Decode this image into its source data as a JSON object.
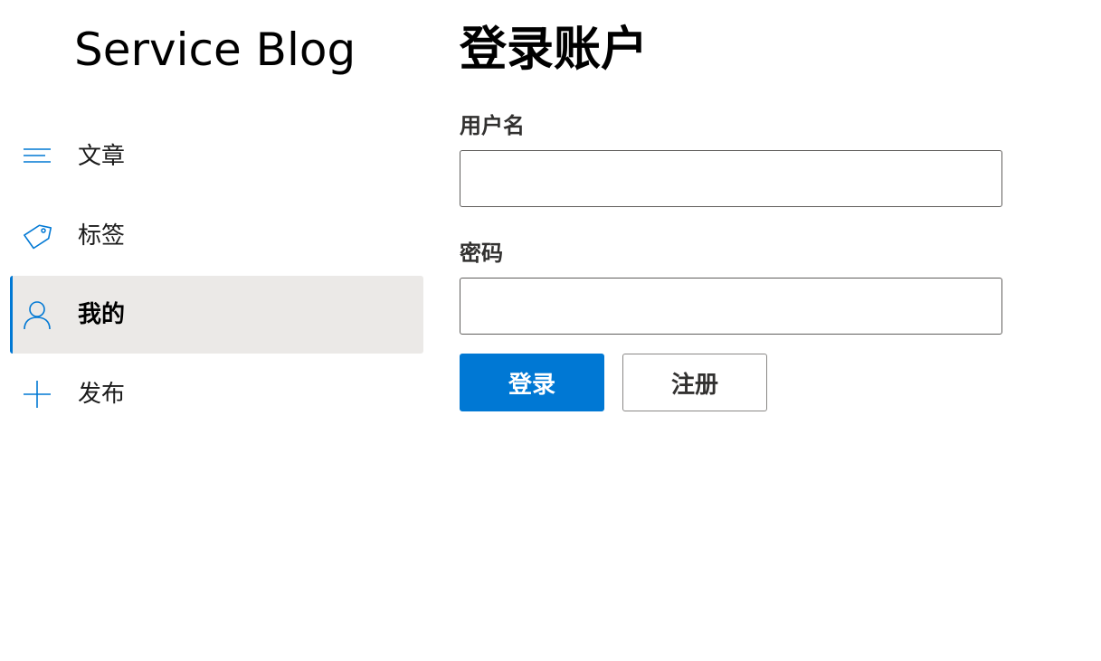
{
  "app": {
    "title": "Service Blog"
  },
  "sidebar": {
    "items": [
      {
        "label": "文章",
        "icon": "lines-icon",
        "active": false
      },
      {
        "label": "标签",
        "icon": "tag-icon",
        "active": false
      },
      {
        "label": "我的",
        "icon": "person-icon",
        "active": true
      },
      {
        "label": "发布",
        "icon": "plus-icon",
        "active": false
      }
    ]
  },
  "login": {
    "title": "登录账户",
    "username_label": "用户名",
    "username_value": "",
    "password_label": "密码",
    "password_value": "",
    "login_button": "登录",
    "register_button": "注册"
  },
  "colors": {
    "accent": "#0078d4",
    "active_background": "#ebe9e7",
    "input_border": "#605e5c"
  }
}
